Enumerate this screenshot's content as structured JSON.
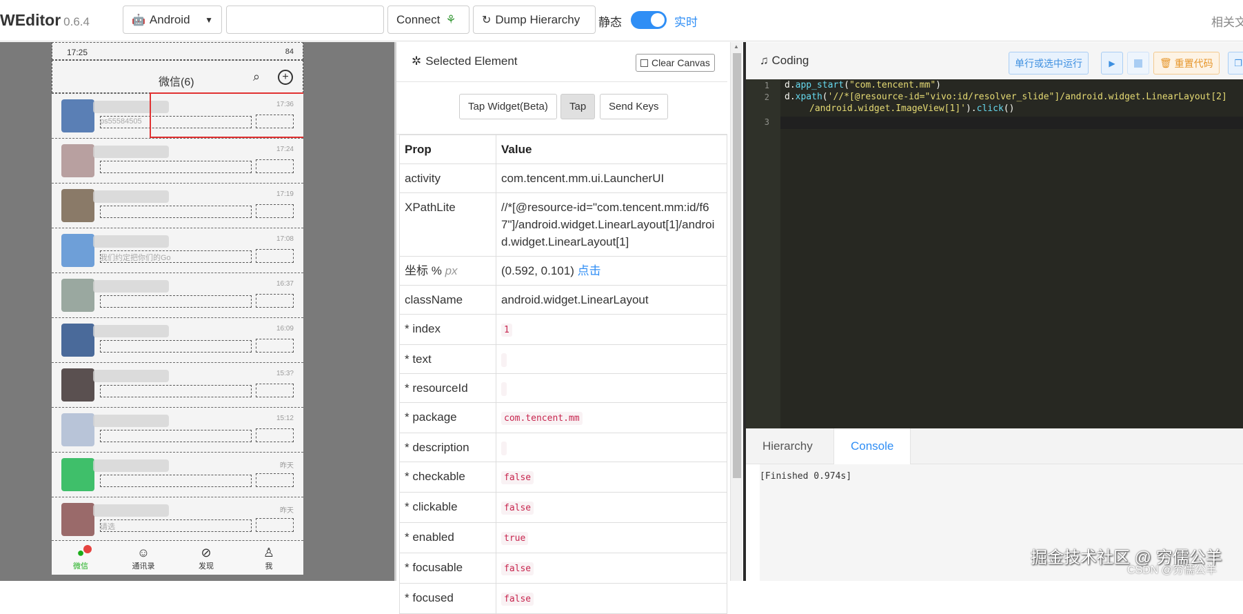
{
  "app": {
    "brand": "WEditor",
    "version": "0.6.4"
  },
  "toolbar": {
    "platform": "Android",
    "serial_value": "",
    "connect_label": "Connect",
    "dump_label": "Dump Hierarchy",
    "mode_static": "静态",
    "mode_live": "实时",
    "related": "相关文"
  },
  "phone": {
    "status_time": "17:25",
    "status_battery": "84",
    "title": "微信(6)",
    "selected_sub": "ps55584505",
    "rows": [
      {
        "time": "17:36",
        "sub": "ps55584505",
        "color": "#5a7fb5"
      },
      {
        "time": "17:24",
        "sub": "",
        "color": "#b8a0a0"
      },
      {
        "time": "17:19",
        "sub": "",
        "color": "#8a7a68"
      },
      {
        "time": "17:08",
        "sub": "我们约定把你们的Go",
        "color": "#6e9fd8"
      },
      {
        "time": "16:37",
        "sub": "",
        "color": "#9aa8a0"
      },
      {
        "time": "16:09",
        "sub": "",
        "color": "#4a6a9a"
      },
      {
        "time": "15:3?",
        "sub": "",
        "color": "#5a5050"
      },
      {
        "time": "15:12",
        "sub": "",
        "color": "#b8c4d8"
      },
      {
        "time": "昨天",
        "sub": "",
        "color": "#3fbf6a"
      },
      {
        "time": "昨天",
        "sub": "请选",
        "color": "#9a6a6a"
      }
    ],
    "tabs": [
      "微信",
      "通讯录",
      "发现",
      "我"
    ]
  },
  "props": {
    "title": "Selected Element",
    "clear_canvas": "Clear Canvas",
    "tap_widget": "Tap Widget(Beta)",
    "tap": "Tap",
    "send_keys": "Send Keys",
    "col_prop": "Prop",
    "col_value": "Value",
    "activity_k": "activity",
    "activity_v": "com.tencent.mm.ui.LauncherUI",
    "xpath_k": "XPathLite",
    "xpath_v": "//*[@resource-id=\"com.tencent.mm:id/f67\"]/android.widget.LinearLayout[1]/android.widget.LinearLayout[1]",
    "coord_k": "坐标 %",
    "coord_px": "px",
    "coord_v": "(0.592, 0.101)",
    "coord_link": "点击",
    "class_k": "className",
    "class_v": "android.widget.LinearLayout",
    "index_k": "* index",
    "index_v": "1",
    "text_k": "* text",
    "resid_k": "* resourceId",
    "package_k": "* package",
    "package_v": "com.tencent.mm",
    "desc_k": "* description",
    "checkable_k": "* checkable",
    "checkable_v": "false",
    "clickable_k": "* clickable",
    "clickable_v": "false",
    "enabled_k": "* enabled",
    "enabled_v": "true",
    "focusable_k": "* focusable",
    "focusable_v": "false",
    "focused_k": "* focused",
    "focused_v": "false"
  },
  "coding": {
    "title": "Coding",
    "run_selected": "单行或选中运行",
    "reset_code": "重置代码",
    "line_numbers": [
      "1",
      "2",
      "3"
    ],
    "line1_obj": "d.",
    "line1_fn": "app_start",
    "line1_arg": "\"com.tencent.mm\"",
    "line2_obj": "d.",
    "line2_fn": "xpath",
    "line2_arg_a": "'//*[@resource-id=\"vivo:id/resolver_slide\"]/android.widget.LinearLayout[2]",
    "line2_arg_b": "/android.widget.ImageView[1]'",
    "line2_tail_fn": "click",
    "tab_hierarchy": "Hierarchy",
    "tab_console": "Console",
    "console_output": "[Finished 0.974s]"
  },
  "watermark": {
    "main": "掘金技术社区 @ 穷儒公羊",
    "csdn": "CSDN @穷儒公羊"
  },
  "colors": {
    "accent": "#2f8ef5",
    "selected_border": "#e03030",
    "editor_bg": "#272822",
    "wechat_green": "#1aad19"
  }
}
